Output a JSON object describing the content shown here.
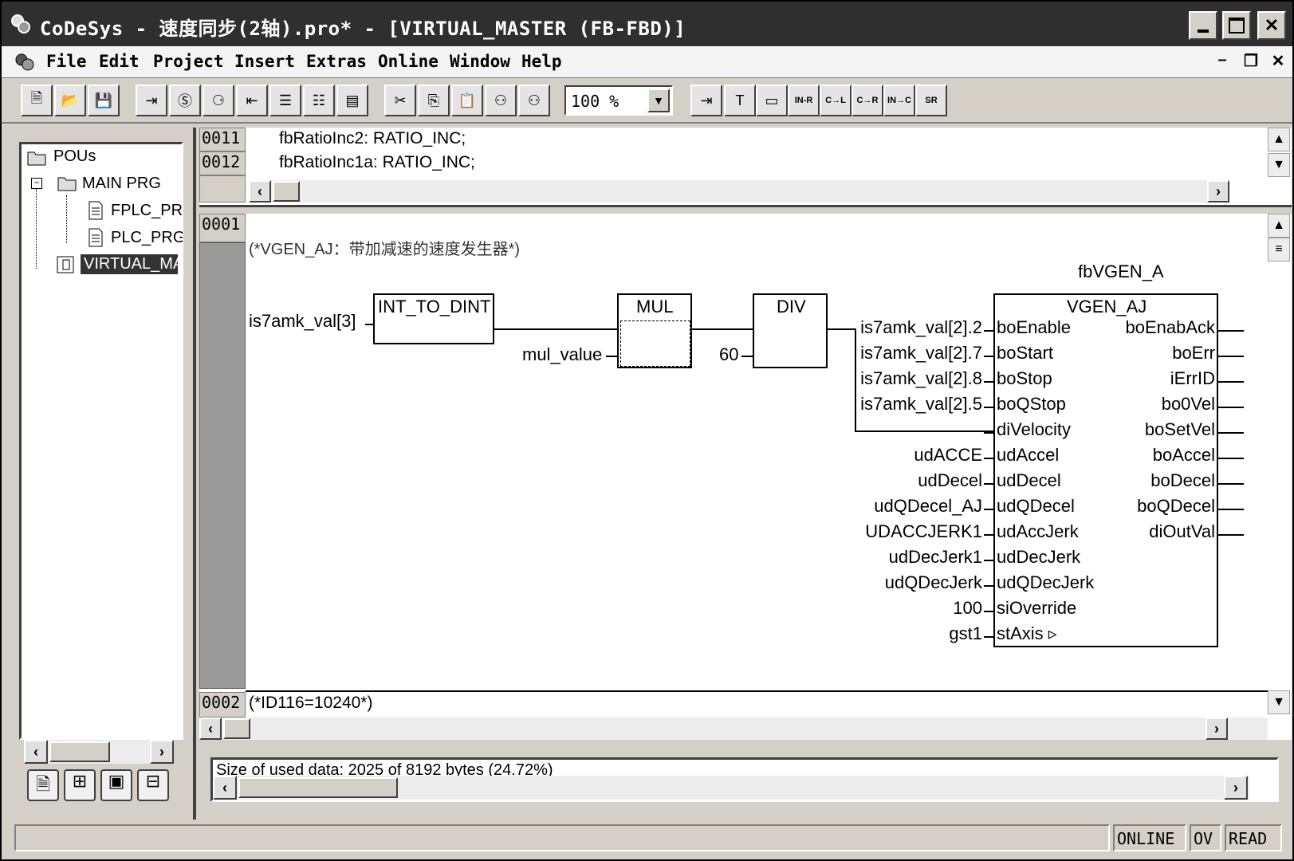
{
  "window": {
    "title": "CoDeSys - 速度同步(2轴).pro* - [VIRTUAL_MASTER (FB-FBD)]"
  },
  "menu": {
    "items": [
      "File",
      "Edit",
      "Project",
      "Insert",
      "Extras",
      "Online",
      "Window",
      "Help"
    ]
  },
  "toolbar": {
    "zoom": "100 %",
    "fbd_buttons": [
      "IN-R",
      "C→L",
      "C→R",
      "IN→C",
      "SR"
    ]
  },
  "tree": {
    "root": "POUs",
    "items": [
      "MAIN PRG",
      "FPLC_PRG",
      "PLC_PRG",
      "VIRTUAL_MASTER"
    ]
  },
  "declaration": {
    "lines": [
      {
        "no": "0011",
        "text": "fbRatioInc2: RATIO_INC;"
      },
      {
        "no": "0012",
        "text": "fbRatioInc1a: RATIO_INC;"
      }
    ]
  },
  "network1": {
    "no": "0001",
    "comment": "(*VGEN_AJ：带加减速的速度发生器*)",
    "input_var": "is7amk_val[3]",
    "int_to_dint": "INT_TO_DINT",
    "mul": "MUL",
    "mul_input": "mul_value",
    "div": "DIV",
    "div_input": "60",
    "instance": "fbVGEN_A",
    "fb_type": "VGEN_AJ",
    "fb_inputs": [
      "boEnable",
      "boStart",
      "boStop",
      "boQStop",
      "diVelocity",
      "udAccel",
      "udDecel",
      "udQDecel",
      "udAccJerk",
      "udDecJerk",
      "udQDecJerk",
      "siOverride",
      "stAxis ▹"
    ],
    "fb_input_vars": [
      "is7amk_val[2].2",
      "is7amk_val[2].7",
      "is7amk_val[2].8",
      "is7amk_val[2].5",
      "",
      "udACCE",
      "udDecel",
      "udQDecel_AJ",
      "UDACCJERK1",
      "udDecJerk1",
      "udQDecJerk",
      "100",
      "gst1"
    ],
    "fb_outputs": [
      "boEnabAck",
      "boErr",
      "iErrID",
      "bo0Vel",
      "boSetVel",
      "boAccel",
      "boDecel",
      "boQDecel",
      "diOutVal"
    ]
  },
  "network2": {
    "no": "0002",
    "comment": "(*ID116=10240*)"
  },
  "messages": {
    "text": "Size of used data: 2025 of 8192 bytes (24.72%)"
  },
  "status": {
    "online": "ONLINE",
    "ov": "OV",
    "read": "READ"
  }
}
